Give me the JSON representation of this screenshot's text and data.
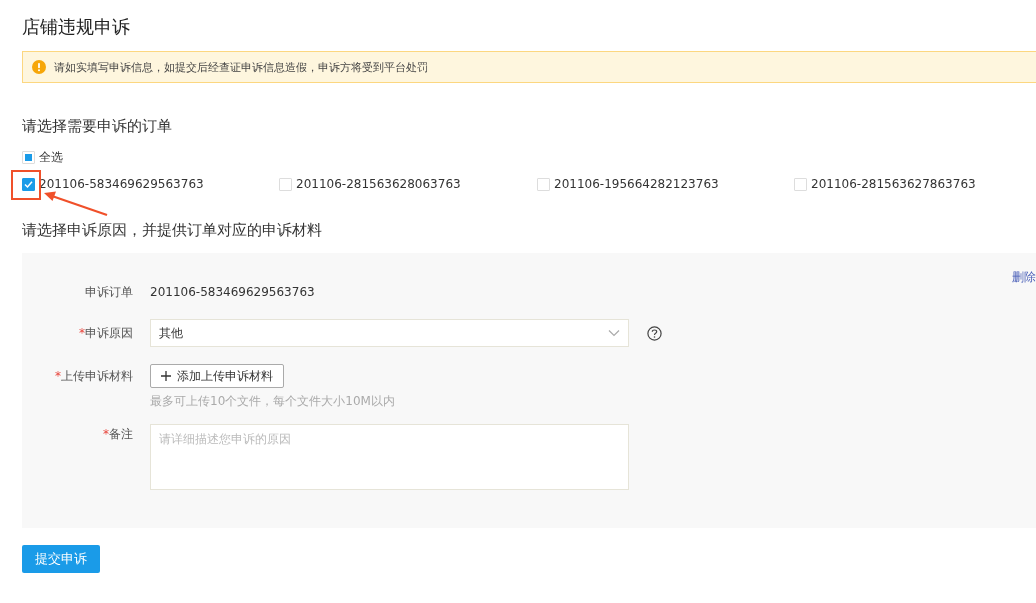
{
  "page_title": "店铺违规申诉",
  "alert": {
    "text": "请如实填写申诉信息，如提交后经查证申诉信息造假，申诉方将受到平台处罚"
  },
  "order_section": {
    "heading": "请选择需要申诉的订单",
    "select_all": {
      "label": "全选",
      "indeterminate": true
    },
    "orders": [
      {
        "label": "201106-583469629563763",
        "checked": true
      },
      {
        "label": "201106-281563628063763",
        "checked": false
      },
      {
        "label": "201106-195664282123763",
        "checked": false
      },
      {
        "label": "201106-281563627863763",
        "checked": false
      }
    ]
  },
  "reason_section": {
    "heading": "请选择申诉原因，并提供订单对应的申诉材料",
    "delete_link": "删除",
    "fields": [
      {
        "kind": "text",
        "label": "申诉订单",
        "value": "201106-583469629563763"
      },
      {
        "kind": "select",
        "required_mark": "*",
        "label": "申诉原因",
        "value": "其他"
      },
      {
        "kind": "upload",
        "required_mark": "*",
        "label": "上传申诉材料",
        "button": "添加上传申诉材料",
        "hint": "最多可上传10个文件，每个文件大小10M以内"
      },
      {
        "kind": "textarea",
        "required_mark": "*",
        "label": "备注",
        "placeholder": "请详细描述您申诉的原因"
      }
    ]
  },
  "submit_button": "提交申诉"
}
